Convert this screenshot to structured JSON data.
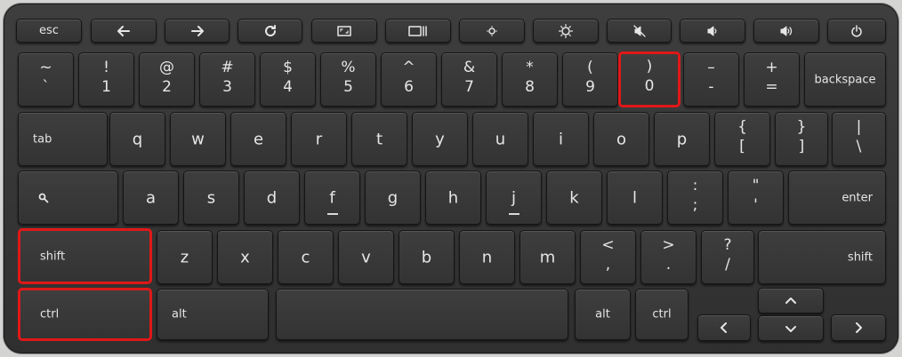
{
  "colors": {
    "keyboard_body": "#333333",
    "key_legend": "#e6e6e6",
    "highlight": "#e01818"
  },
  "function_row": {
    "esc": "esc",
    "icons": [
      "back-arrow-icon",
      "forward-arrow-icon",
      "refresh-icon",
      "fullscreen-icon",
      "overview-windows-icon",
      "brightness-down-icon",
      "brightness-up-icon",
      "mute-icon",
      "volume-down-icon",
      "volume-up-icon",
      "power-icon"
    ]
  },
  "number_row": [
    {
      "top": "~",
      "bottom": "`"
    },
    {
      "top": "!",
      "bottom": "1"
    },
    {
      "top": "@",
      "bottom": "2"
    },
    {
      "top": "#",
      "bottom": "3"
    },
    {
      "top": "$",
      "bottom": "4"
    },
    {
      "top": "%",
      "bottom": "5"
    },
    {
      "top": "^",
      "bottom": "6"
    },
    {
      "top": "&",
      "bottom": "7"
    },
    {
      "top": "*",
      "bottom": "8"
    },
    {
      "top": "(",
      "bottom": "9"
    },
    {
      "top": ")",
      "bottom": "0"
    },
    {
      "top": "–",
      "bottom": "-"
    },
    {
      "top": "+",
      "bottom": "="
    }
  ],
  "backspace": "backspace",
  "tab": "tab",
  "qwerty_row": [
    "q",
    "w",
    "e",
    "r",
    "t",
    "y",
    "u",
    "i",
    "o",
    "p"
  ],
  "bracket_keys": [
    {
      "top": "{",
      "bottom": "["
    },
    {
      "top": "}",
      "bottom": "]"
    },
    {
      "top": "|",
      "bottom": "\\"
    }
  ],
  "home_row": [
    "a",
    "s",
    "d",
    "f",
    "g",
    "h",
    "j",
    "k",
    "l"
  ],
  "home_punct": [
    {
      "top": ":",
      "bottom": ";"
    },
    {
      "top": "\"",
      "bottom": "'"
    }
  ],
  "enter": "enter",
  "shift_left": "shift",
  "bottom_letters": [
    "z",
    "x",
    "c",
    "v",
    "b",
    "n",
    "m"
  ],
  "bottom_punct": [
    {
      "top": "<",
      "bottom": ","
    },
    {
      "top": ">",
      "bottom": "."
    },
    {
      "top": "?",
      "bottom": "/"
    }
  ],
  "shift_right": "shift",
  "ctrl_left": "ctrl",
  "alt_left": "alt",
  "alt_right": "alt",
  "ctrl_right": "ctrl"
}
